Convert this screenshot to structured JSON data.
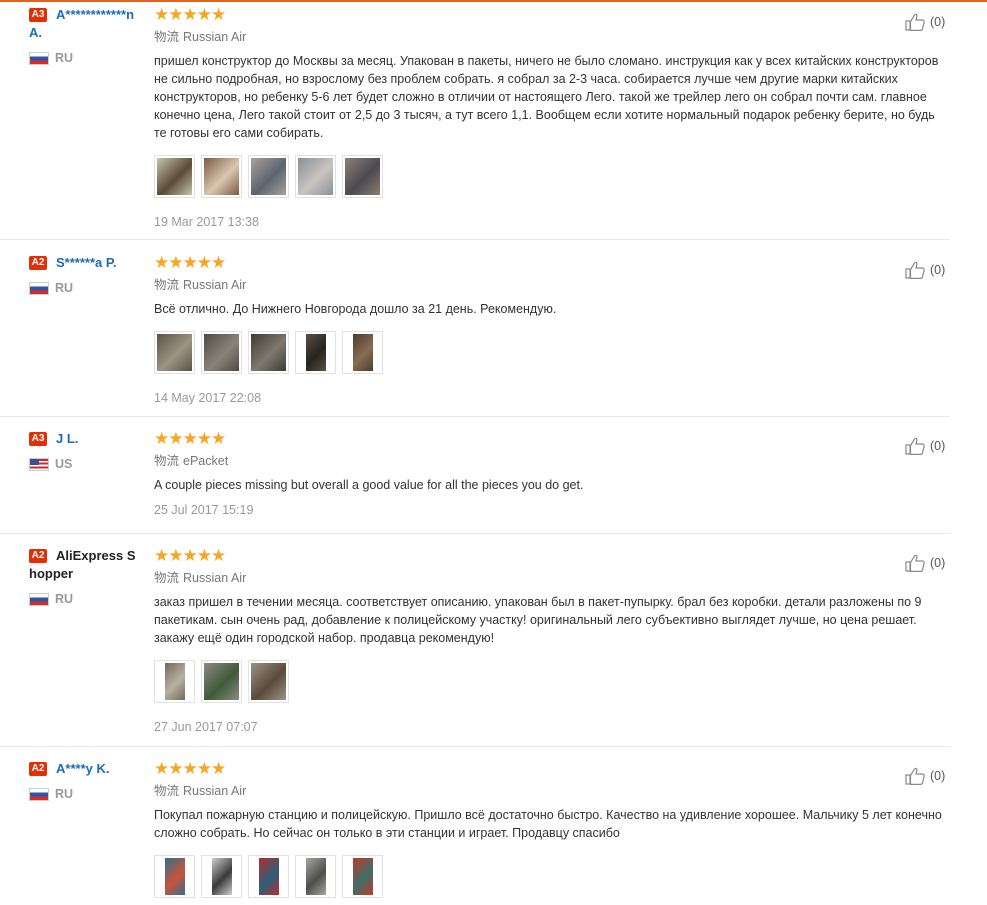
{
  "shipping_label": "物流",
  "reviews": [
    {
      "level": "A3",
      "name": "A************n A.",
      "name_style": "link",
      "country": "RU",
      "flag": "ru",
      "shipping": "Russian Air",
      "text": "пришел конструктор до Москвы за месяц. Упакован в пакеты, ничего не было сломано. инструкция как у всех китайских конструкторов не сильно подробная, но взрослому без проблем собрать. я собрал за 2-3 часа. собирается лучше чем другие марки китайских конструкторов, но ребенку 5-6 лет будет сложно в отличии от настоящего Лего. такой же трейлер лего он собрал почти сам. главное конечно цена, Лего такой стоит от 2,5 до 3 тысяч, а тут всего 1,1. Вообщем если хотите нормальный подарок ребенку берите, но будь те готовы его сами собирать.",
      "date": "19 Mar 2017 13:38",
      "likes": "(0)",
      "photos": [
        {
          "colors": [
            "#c9c2b0",
            "#5a4a35"
          ],
          "narrow": false
        },
        {
          "colors": [
            "#7b5a43",
            "#d9c7b0"
          ],
          "narrow": false
        },
        {
          "colors": [
            "#a9a29a",
            "#5c6470"
          ],
          "narrow": false
        },
        {
          "colors": [
            "#8d8f96",
            "#c9c4bd"
          ],
          "narrow": false
        },
        {
          "colors": [
            "#8a7f78",
            "#4c4a4e"
          ],
          "narrow": false
        }
      ]
    },
    {
      "level": "A2",
      "name": "S******a P.",
      "name_style": "link",
      "country": "RU",
      "flag": "ru",
      "shipping": "Russian Air",
      "text": "Всё отлично. До Нижнего Новгорода дошло за 21 день. Рекомендую.",
      "date": "14 May 2017 22:08",
      "likes": "(0)",
      "photos": [
        {
          "colors": [
            "#5b5347",
            "#9d9484"
          ],
          "narrow": false
        },
        {
          "colors": [
            "#4e4a44",
            "#8a8378"
          ],
          "narrow": false
        },
        {
          "colors": [
            "#3f3c36",
            "#7e786d"
          ],
          "narrow": false
        },
        {
          "colors": [
            "#5a4f42",
            "#27231f"
          ],
          "narrow": true
        },
        {
          "colors": [
            "#4a3c30",
            "#8a6d55"
          ],
          "narrow": true
        }
      ]
    },
    {
      "level": "A3",
      "name": "J L.",
      "name_style": "link",
      "country": "US",
      "flag": "us",
      "shipping": "ePacket",
      "text": "A couple pieces missing but overall a good value for all the pieces you do get.",
      "date": "25 Jul 2017 15:19",
      "likes": "(0)",
      "photos": []
    },
    {
      "level": "A2",
      "name": "AliExpress Shopper",
      "name_style": "plain",
      "country": "RU",
      "flag": "ru",
      "shipping": "Russian Air",
      "text": "заказ пришел в течении месяца. соответствует описанию. упакован был в пакет-пупырку. брал без коробки. детали разложены по 9 пакетикам. сын очень рад, добавление к полицейскому участку! оригинальный лего субъективно выглядет лучше, но цена решает. закажу ещё один городской набор. продавца рекомендую!",
      "date": "27 Jun 2017 07:07",
      "likes": "(0)",
      "photos": [
        {
          "colors": [
            "#6e6a5e",
            "#b9b19f"
          ],
          "narrow": true
        },
        {
          "colors": [
            "#8c8b82",
            "#3e5a3a"
          ],
          "narrow": false
        },
        {
          "colors": [
            "#9a9488",
            "#5b4a3a"
          ],
          "narrow": false
        }
      ]
    },
    {
      "level": "A2",
      "name": "A****y K.",
      "name_style": "link",
      "country": "RU",
      "flag": "ru",
      "shipping": "Russian Air",
      "text": "Покупал пожарную станцию и полицейскую. Пришло всё достаточно быстро. Качество на удивление хорошее. Мальчику 5 лет конечно сложно собрать. Но сейчас он только в эти станции и играет. Продавцу спасибо",
      "date": "",
      "likes": "(0)",
      "photos": [
        {
          "colors": [
            "#2f6f8a",
            "#c9533c"
          ],
          "narrow": true
        },
        {
          "colors": [
            "#cfcfcf",
            "#3a3a3a"
          ],
          "narrow": true
        },
        {
          "colors": [
            "#b72d2d",
            "#2c5f7a"
          ],
          "narrow": true
        },
        {
          "colors": [
            "#a7a7a0",
            "#4f4f4a"
          ],
          "narrow": true
        },
        {
          "colors": [
            "#c23a2e",
            "#3c6e66"
          ],
          "narrow": true
        }
      ]
    }
  ]
}
